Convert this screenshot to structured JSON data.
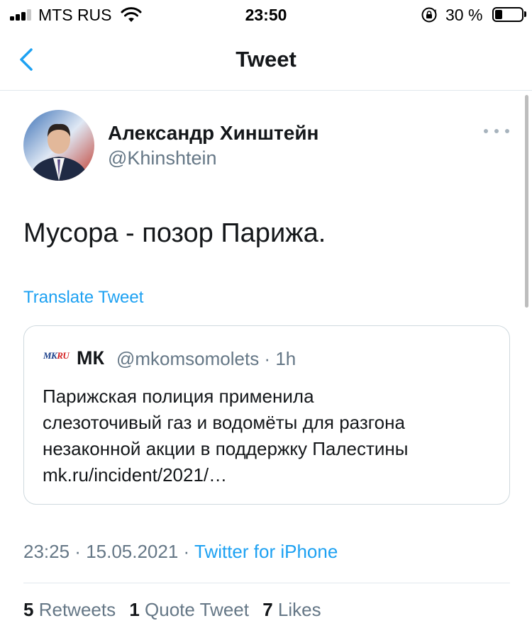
{
  "status_bar": {
    "carrier": "MTS RUS",
    "time": "23:50",
    "battery_percent": "30 %",
    "battery_level": 0.3,
    "signal_bars": 3
  },
  "nav": {
    "title": "Tweet",
    "back_icon": "chevron-left-icon"
  },
  "tweet": {
    "author_name": "Александр Хинштейн",
    "author_handle": "@Khinshtein",
    "text": "Мусора - позор Парижа.",
    "translate_label": "Translate Tweet",
    "more_icon": "more-horizontal-icon"
  },
  "quote": {
    "logo_text": "MKRU",
    "name": "МК",
    "handle": "@mkomsomolets · 1h",
    "text_lines": [
      "Парижская полиция применила",
      "слезоточивый газ и водомёты для разгона",
      "незаконной акции в поддержку Палестины",
      "mk.ru/incident/2021/…"
    ]
  },
  "meta": {
    "time": "23:25",
    "separator": " · ",
    "date": "15.05.2021",
    "source": "Twitter for iPhone"
  },
  "stats": {
    "retweets_count": "5",
    "retweets_label": "Retweets",
    "quotes_count": "1",
    "quotes_label": "Quote Tweet",
    "likes_count": "7",
    "likes_label": "Likes"
  },
  "colors": {
    "accent": "#1da1f2",
    "secondary_text": "#657786",
    "primary_text": "#14171a",
    "border": "#cfd9de"
  }
}
